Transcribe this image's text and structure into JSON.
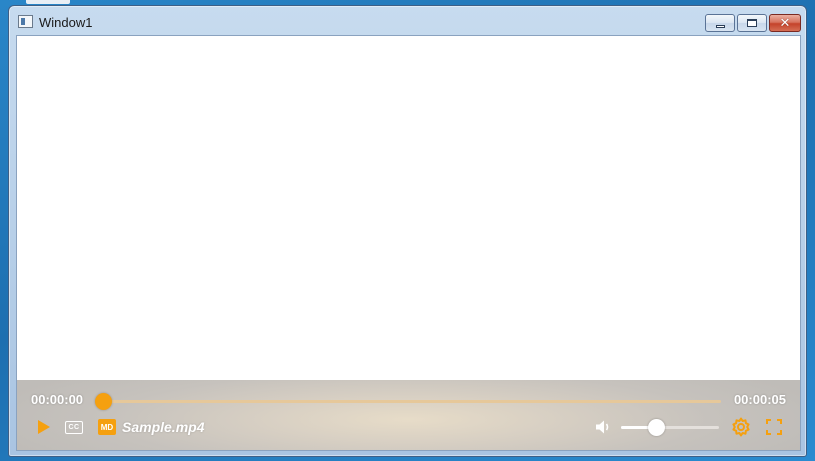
{
  "window": {
    "title": "Window1"
  },
  "player": {
    "current_time": "00:00:00",
    "total_time": "00:00:05",
    "progress": 0.0,
    "file_name": "Sample.mp4",
    "cc_label": "CC",
    "media_label": "MD",
    "volume": 0.36,
    "accent_color": "#f5a00f"
  },
  "icons": {
    "play": "play-icon",
    "cc": "closed-captions-icon",
    "media": "media-file-icon",
    "volume": "speaker-icon",
    "settings": "gear-icon",
    "fullscreen": "fullscreen-icon",
    "minimize": "minimize-icon",
    "maximize": "maximize-icon",
    "close": "close-icon"
  }
}
